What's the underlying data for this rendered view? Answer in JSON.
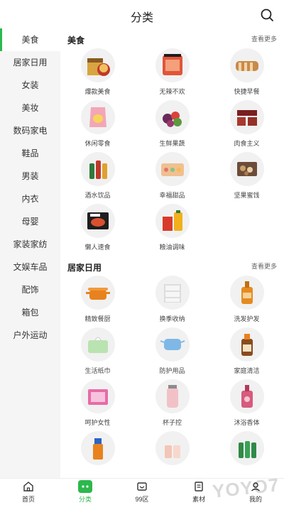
{
  "header": {
    "title": "分类"
  },
  "sidebar": {
    "items": [
      {
        "label": "美食",
        "active": true
      },
      {
        "label": "居家日用"
      },
      {
        "label": "女装"
      },
      {
        "label": "美妆"
      },
      {
        "label": "数码家电"
      },
      {
        "label": "鞋品"
      },
      {
        "label": "男装"
      },
      {
        "label": "内衣"
      },
      {
        "label": "母婴"
      },
      {
        "label": "家装家纺"
      },
      {
        "label": "文娱车品"
      },
      {
        "label": "配饰"
      },
      {
        "label": "箱包"
      },
      {
        "label": "户外运动"
      }
    ]
  },
  "sections": [
    {
      "title": "美食",
      "more": "查看更多",
      "items": [
        {
          "label": "爆款美食",
          "icon": "noodle-box-icon"
        },
        {
          "label": "无辣不欢",
          "icon": "spicy-meat-icon"
        },
        {
          "label": "快捷早餐",
          "icon": "bread-icon"
        },
        {
          "label": "休闲零食",
          "icon": "snack-bag-icon"
        },
        {
          "label": "生鲜果蔬",
          "icon": "fruit-icon"
        },
        {
          "label": "肉食主义",
          "icon": "meat-icon"
        },
        {
          "label": "酒水饮品",
          "icon": "bottles-icon"
        },
        {
          "label": "幸福甜品",
          "icon": "dessert-icon"
        },
        {
          "label": "坚果蜜饯",
          "icon": "nuts-icon"
        },
        {
          "label": "懒人速食",
          "icon": "instant-food-icon"
        },
        {
          "label": "粮油调味",
          "icon": "oil-rice-icon"
        }
      ]
    },
    {
      "title": "居家日用",
      "more": "查看更多",
      "items": [
        {
          "label": "精致餐厨",
          "icon": "pot-icon"
        },
        {
          "label": "换季收纳",
          "icon": "storage-drawer-icon"
        },
        {
          "label": "洗发护发",
          "icon": "shampoo-icon"
        },
        {
          "label": "生活纸巾",
          "icon": "tissue-icon"
        },
        {
          "label": "防护用品",
          "icon": "mask-icon"
        },
        {
          "label": "家庭清洁",
          "icon": "disinfectant-icon"
        },
        {
          "label": "呵护女性",
          "icon": "sanitary-pad-icon"
        },
        {
          "label": "杯子控",
          "icon": "cup-icon"
        },
        {
          "label": "沐浴香体",
          "icon": "body-wash-icon"
        },
        {
          "label": "",
          "icon": "cleaner-spray-icon"
        },
        {
          "label": "",
          "icon": "toothbrush-cup-icon"
        },
        {
          "label": "",
          "icon": "green-bottles-icon"
        }
      ]
    }
  ],
  "tabbar": {
    "items": [
      {
        "label": "首页",
        "icon": "home-icon"
      },
      {
        "label": "分类",
        "icon": "category-icon",
        "active": true
      },
      {
        "label": "99区",
        "icon": "ticket-icon"
      },
      {
        "label": "素材",
        "icon": "material-icon"
      },
      {
        "label": "我的",
        "icon": "profile-icon"
      }
    ]
  },
  "watermark": "YOYO7"
}
